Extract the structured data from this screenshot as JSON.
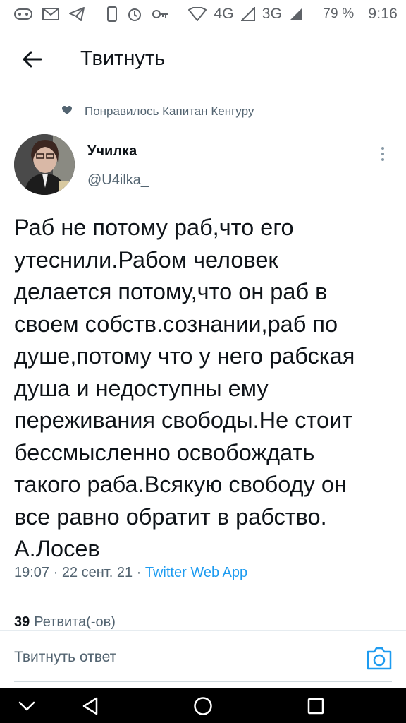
{
  "status_bar": {
    "network_4g": "4G",
    "network_3g": "3G",
    "battery": "79 %",
    "time": "9:16",
    "icons": [
      "gamepad-icon",
      "mail-icon",
      "telegram-icon",
      "phone-icon",
      "alarm-icon",
      "key-icon",
      "wifi-icon",
      "signal-icon",
      "signal-icon"
    ]
  },
  "header": {
    "title": "Твитнуть"
  },
  "social_context": {
    "text": "Понравилось Капитан Кенгуру"
  },
  "author": {
    "name": "Училка",
    "handle": "@U4ilka_"
  },
  "tweet": {
    "text": "Раб не потому раб,что его\nутеснили.Рабом человек\nделается потому,что он раб в\nсвоем собств.сознании,раб по\nдуше,потому что у него рабская\nдуша и недоступны ему\nпереживания свободы.Не стоит\nбессмысленно освобождать\nтакого раба.Всякую свободу он\nвсе равно обратит в рабство.\nА.Лосев",
    "timestamp": "19:07 · 22 сент. 21 · ",
    "source": "Twitter Web App"
  },
  "stats": {
    "retweet_count": "39",
    "retweet_label": "Ретвита(-ов)"
  },
  "reply": {
    "placeholder": "Твитнуть ответ"
  },
  "colors": {
    "accent": "#1d9bf0",
    "text_primary": "#0f1419",
    "text_secondary": "#536471"
  }
}
